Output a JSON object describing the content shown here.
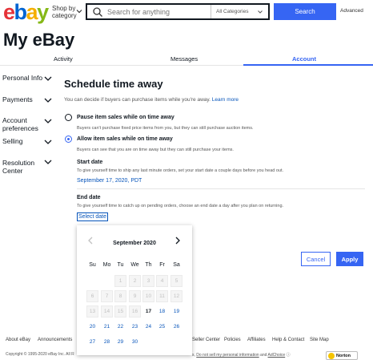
{
  "header": {
    "logo": "ebay",
    "shop_by_line1": "Shop by",
    "shop_by_line2": "category",
    "search_placeholder": "Search for anything",
    "category_selected": "All Categories",
    "search_button": "Search",
    "advanced": "Advanced"
  },
  "page_title": "My eBay",
  "tabs": {
    "activity": "Activity",
    "messages": "Messages",
    "account": "Account"
  },
  "sidebar": {
    "personal_info": "Personal Info",
    "payments": "Payments",
    "account_pref_1": "Account",
    "account_pref_2": "preferences",
    "selling": "Selling",
    "resolution_1": "Resolution",
    "resolution_2": "Center"
  },
  "main": {
    "heading": "Schedule time away",
    "intro": "You can decide if buyers can purchase items while you're away.",
    "learn_more": "Learn more",
    "option_pause_label": "Pause item sales while on time away",
    "option_pause_desc": "Buyers can't purchase fixed price items from you, but they can still purchase auction items.",
    "option_allow_label": "Allow item sales while on time away",
    "option_allow_desc": "Buyers can see that you are on time away but they can still purchase your items.",
    "selected_option": "allow",
    "start_heading": "Start date",
    "start_desc": "To give yourself time to ship any last minute orders, set your start date a couple days before you head out.",
    "start_value": "September 17, 2020, PDT",
    "end_heading": "End date",
    "end_desc": "To give yourself time to catch up on pending orders, choose an end date a day after you plan on returning.",
    "select_date": "Select date",
    "cancel": "Cancel",
    "apply": "Apply"
  },
  "calendar": {
    "month": "September 2020",
    "weekdays": [
      "Su",
      "Mo",
      "Tu",
      "We",
      "Th",
      "Fr",
      "Sa"
    ],
    "first_weekday_index": 2,
    "days_shown": 30,
    "today": 17
  },
  "footer": {
    "about": "About eBay",
    "announcements": "Announcements",
    "seller_center": "Seller Center",
    "policies": "Policies",
    "affiliates": "Affiliates",
    "help": "Help & Contact",
    "sitemap": "Site Map",
    "copyright": "Copyright © 1995-2020 eBay Inc. All R",
    "copy_right_prefix": "s,",
    "do_not_sell": "Do not sell my personal information",
    "and": "and",
    "adchoice": "AdChoice",
    "norton": "Norton"
  },
  "colors": {
    "brand_blue": "#3665f3",
    "link_blue": "#0654ba"
  }
}
